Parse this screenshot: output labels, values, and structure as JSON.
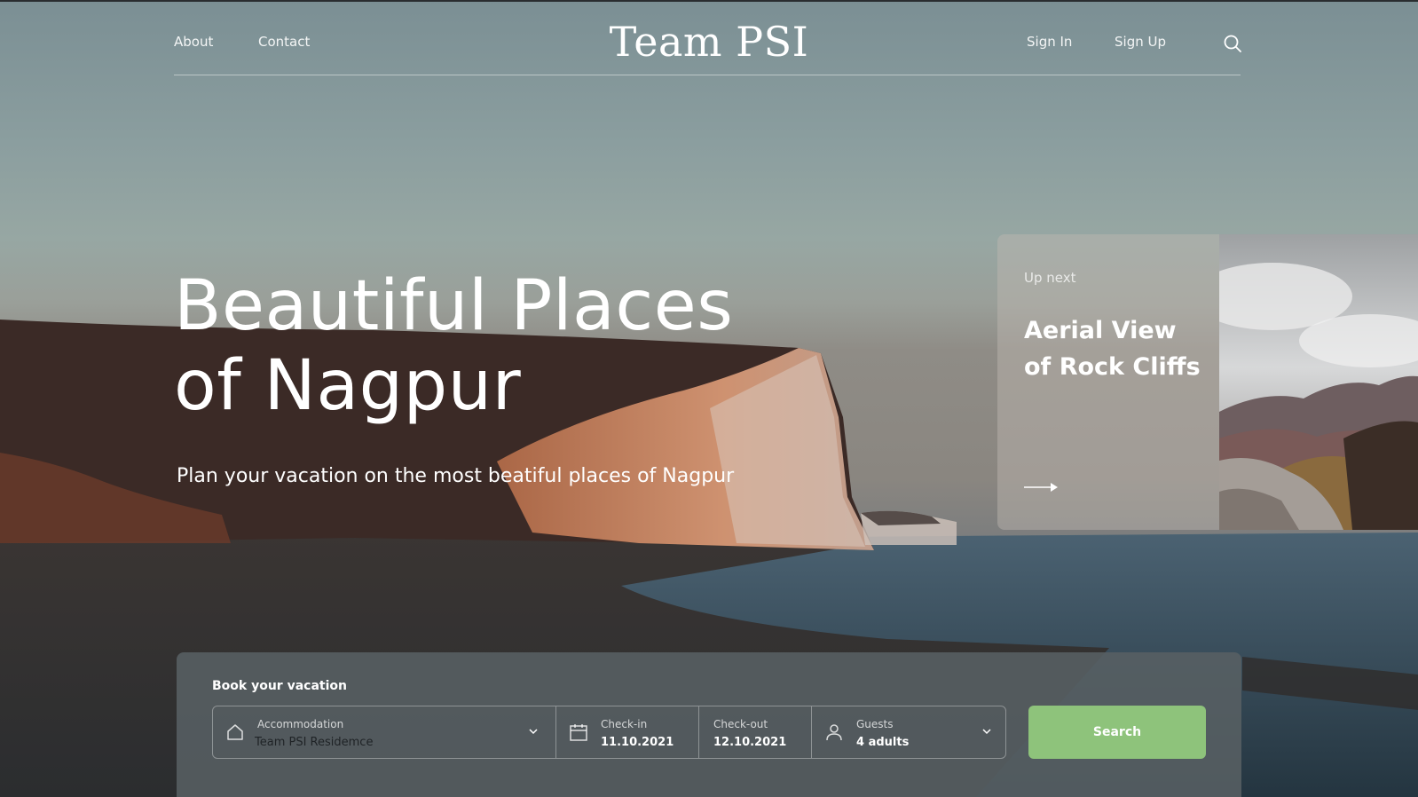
{
  "header": {
    "nav_left": [
      "About",
      "Contact"
    ],
    "logo": "Team PSI",
    "nav_right": [
      "Sign In",
      "Sign Up"
    ],
    "search_icon": "search-icon"
  },
  "hero": {
    "title_line1": "Beautiful Places",
    "title_line2": "of Nagpur",
    "subtitle": "Plan your vacation on the most beatiful places of Nagpur"
  },
  "up_next": {
    "label": "Up next",
    "title": "Aerial View of Rock Cliffs",
    "arrow_icon": "arrow-right-icon"
  },
  "booking": {
    "title": "Book your vacation",
    "accommodation": {
      "label": "Accommodation",
      "value": "Team PSI Residemce",
      "icon": "home-icon"
    },
    "check_in": {
      "label": "Check-in",
      "value": "11.10.2021",
      "icon": "calendar-icon"
    },
    "check_out": {
      "label": "Check-out",
      "value": "12.10.2021"
    },
    "guests": {
      "label": "Guests",
      "value": "4 adults",
      "icon": "user-icon"
    },
    "search_label": "Search"
  },
  "colors": {
    "accent": "#8ec37b",
    "text": "#ffffff"
  }
}
